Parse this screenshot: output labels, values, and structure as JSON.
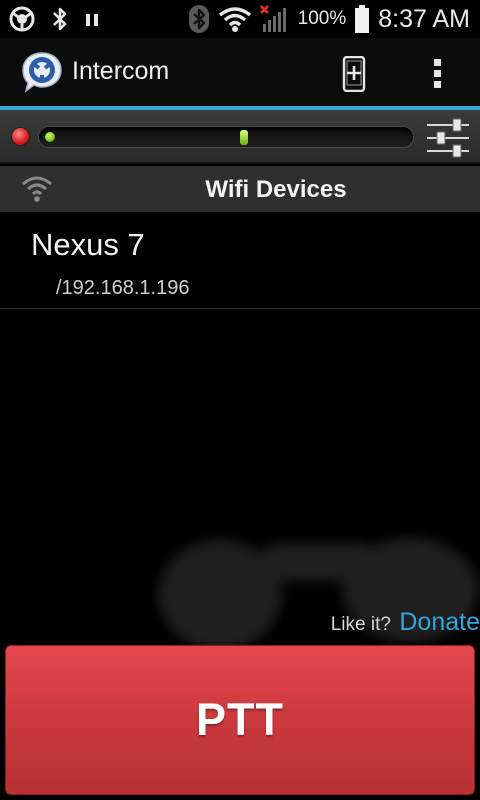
{
  "status_bar": {
    "battery_percent": "100%",
    "clock": "8:37 AM",
    "icons": [
      "app-notification-icon",
      "bluetooth-icon",
      "pause-icon",
      "bluetooth-status-icon",
      "wifi-icon",
      "signal-no-service-icon",
      "battery-icon"
    ]
  },
  "action_bar": {
    "title": "Intercom",
    "logo": "intercom-logo-icon",
    "actions": [
      "add-device-icon",
      "overflow-menu-icon"
    ],
    "accent_color": "#33a2d8"
  },
  "level_bar": {
    "record_indicator": "record-dot-icon",
    "level_fraction": 0.0,
    "slider_fraction": 0.55,
    "settings": "equalizer-icon"
  },
  "section": {
    "icon": "wifi-signal-icon",
    "title": "Wifi Devices"
  },
  "devices": [
    {
      "name": "Nexus 7",
      "address": "/192.168.1.196"
    }
  ],
  "donate": {
    "prompt": "Like it?",
    "link": "Donate",
    "link_color": "#33a7e0"
  },
  "ptt": {
    "label": "PTT",
    "color": "#d13c40"
  }
}
